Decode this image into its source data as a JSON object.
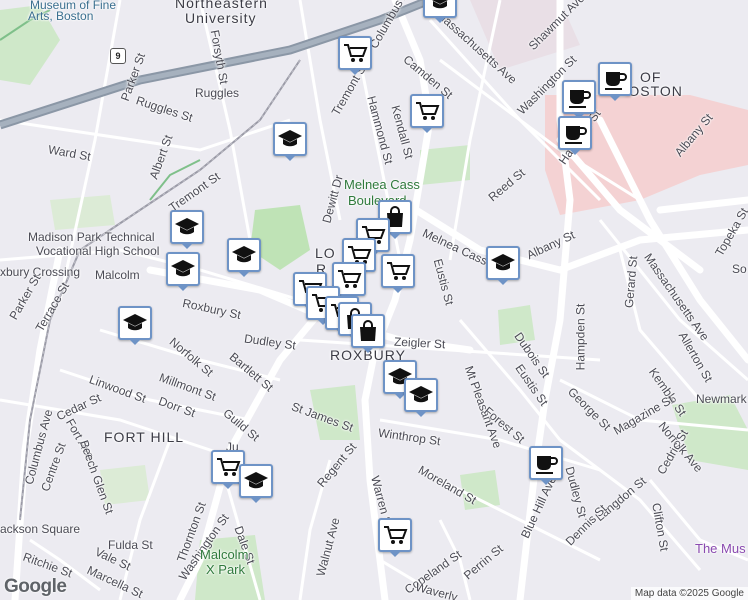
{
  "map": {
    "attribution": "Map data ©2025 Google",
    "logo": "Google",
    "labels": [
      {
        "id": "mfa",
        "text": "Museum of Fine",
        "cls": "teal"
      },
      {
        "id": "mfa2",
        "text": "Arts, Boston",
        "cls": "teal"
      },
      {
        "id": "neu",
        "text": "Northeastern",
        "cls": "big"
      },
      {
        "id": "neu2",
        "text": "University",
        "cls": "big"
      },
      {
        "id": "ruggles",
        "text": "Ruggles",
        "cls": ""
      },
      {
        "id": "ruggles_st",
        "text": "Ruggles St",
        "cls": ""
      },
      {
        "id": "parker",
        "text": "Parker St",
        "cls": ""
      },
      {
        "id": "forsyth",
        "text": "Forsyth St",
        "cls": ""
      },
      {
        "id": "ward",
        "text": "Ward St",
        "cls": ""
      },
      {
        "id": "albert",
        "text": "Albert St",
        "cls": ""
      },
      {
        "id": "tremont",
        "text": "Tremont St",
        "cls": ""
      },
      {
        "id": "tremont2",
        "text": "Tremont St",
        "cls": ""
      },
      {
        "id": "columbus_top",
        "text": "Columbus Av",
        "cls": ""
      },
      {
        "id": "hammond",
        "text": "Hammond St",
        "cls": ""
      },
      {
        "id": "kendall",
        "text": "Kendall St",
        "cls": ""
      },
      {
        "id": "camden",
        "text": "Camden St",
        "cls": ""
      },
      {
        "id": "mass_ave",
        "text": "Massachusetts Ave",
        "cls": ""
      },
      {
        "id": "shawmut",
        "text": "Shawmut Ave",
        "cls": ""
      },
      {
        "id": "washington",
        "text": "Washington St",
        "cls": ""
      },
      {
        "id": "of_boston",
        "text": "OF",
        "cls": "big"
      },
      {
        "id": "of_boston2",
        "text": "BOSTON",
        "cls": "big"
      },
      {
        "id": "dewitt",
        "text": "Dewitt Dr",
        "cls": ""
      },
      {
        "id": "melnea",
        "text": "Melnea Cass",
        "cls": "green"
      },
      {
        "id": "melnea2",
        "text": "Boulevard",
        "cls": "green"
      },
      {
        "id": "reed",
        "text": "Reed St",
        "cls": ""
      },
      {
        "id": "albany",
        "text": "Albany St",
        "cls": ""
      },
      {
        "id": "albany2",
        "text": "Albany St",
        "cls": ""
      },
      {
        "id": "hampton",
        "text": "Hampton St",
        "cls": ""
      },
      {
        "id": "madison",
        "text": "Madison Park Technical",
        "cls": ""
      },
      {
        "id": "madison2",
        "text": "Vocational High School",
        "cls": ""
      },
      {
        "id": "lo",
        "text": "LO",
        "cls": "big"
      },
      {
        "id": "ro",
        "text": "R",
        "cls": "big"
      },
      {
        "id": "melnea_cass",
        "text": "Melnea Cass",
        "cls": ""
      },
      {
        "id": "malcolm",
        "text": "Malcolm",
        "cls": ""
      },
      {
        "id": "xcrossing",
        "text": "xbury Crossing",
        "cls": ""
      },
      {
        "id": "roxbury_st",
        "text": "Roxbury St",
        "cls": ""
      },
      {
        "id": "parker2",
        "text": "Parker St",
        "cls": ""
      },
      {
        "id": "terrace",
        "text": "Terrace St",
        "cls": ""
      },
      {
        "id": "dudley",
        "text": "Dudley St",
        "cls": ""
      },
      {
        "id": "roxbury",
        "text": "ROXBURY",
        "cls": "big"
      },
      {
        "id": "zeigler",
        "text": "Zeigler St",
        "cls": ""
      },
      {
        "id": "eustis",
        "text": "Eustis St",
        "cls": ""
      },
      {
        "id": "eustis2",
        "text": "Eustis St",
        "cls": ""
      },
      {
        "id": "dubois",
        "text": "Dubois St",
        "cls": ""
      },
      {
        "id": "hampden",
        "text": "Hampden St",
        "cls": ""
      },
      {
        "id": "gerard",
        "text": "Gerard St",
        "cls": ""
      },
      {
        "id": "mass_ave2",
        "text": "Massachusetts Ave",
        "cls": ""
      },
      {
        "id": "topeka",
        "text": "Topeka St",
        "cls": ""
      },
      {
        "id": "so",
        "text": "So",
        "cls": ""
      },
      {
        "id": "allerton",
        "text": "Allerton St",
        "cls": ""
      },
      {
        "id": "kemble",
        "text": "Kemble St",
        "cls": ""
      },
      {
        "id": "newmark",
        "text": "Newmark",
        "cls": ""
      },
      {
        "id": "george",
        "text": "George St",
        "cls": ""
      },
      {
        "id": "magazine",
        "text": "Magazine St",
        "cls": ""
      },
      {
        "id": "norfolk_ave",
        "text": "Norfolk Ave",
        "cls": ""
      },
      {
        "id": "cedric",
        "text": "Cedric St",
        "cls": ""
      },
      {
        "id": "mt_pleasant",
        "text": "Mt Pleasant Ave",
        "cls": ""
      },
      {
        "id": "forest",
        "text": "Forest St",
        "cls": ""
      },
      {
        "id": "norfolk",
        "text": "Norfolk St",
        "cls": ""
      },
      {
        "id": "bartlett",
        "text": "Bartlett St",
        "cls": ""
      },
      {
        "id": "linwood",
        "text": "Linwood St",
        "cls": ""
      },
      {
        "id": "millmont",
        "text": "Millmont St",
        "cls": ""
      },
      {
        "id": "dorr",
        "text": "Dorr St",
        "cls": ""
      },
      {
        "id": "cedar",
        "text": "Cedar St",
        "cls": ""
      },
      {
        "id": "columbus",
        "text": "Columbus Ave",
        "cls": ""
      },
      {
        "id": "guild",
        "text": "Guild St",
        "cls": ""
      },
      {
        "id": "st_james",
        "text": "St James St",
        "cls": ""
      },
      {
        "id": "winthrop",
        "text": "Winthrop St",
        "cls": ""
      },
      {
        "id": "fort_hill",
        "text": "FORT HILL",
        "cls": "big"
      },
      {
        "id": "fort_ave",
        "text": "Fort Ave",
        "cls": ""
      },
      {
        "id": "centre",
        "text": "Centre St",
        "cls": ""
      },
      {
        "id": "beech",
        "text": "Beech Glen St",
        "cls": ""
      },
      {
        "id": "ju",
        "text": "Ju",
        "cls": ""
      },
      {
        "id": "regent",
        "text": "Regent St",
        "cls": ""
      },
      {
        "id": "moreland",
        "text": "Moreland St",
        "cls": ""
      },
      {
        "id": "blue_hill",
        "text": "Blue Hill Ave",
        "cls": ""
      },
      {
        "id": "dudley_st2",
        "text": "Dudley St",
        "cls": ""
      },
      {
        "id": "langdon",
        "text": "Langdon St",
        "cls": ""
      },
      {
        "id": "dennis",
        "text": "Dennis St",
        "cls": ""
      },
      {
        "id": "clifton",
        "text": "Clifton St",
        "cls": ""
      },
      {
        "id": "museum",
        "text": "The Mus",
        "cls": "purple"
      },
      {
        "id": "jackson",
        "text": "ackson Square",
        "cls": ""
      },
      {
        "id": "ritchie",
        "text": "Ritchie St",
        "cls": ""
      },
      {
        "id": "vale",
        "text": "Vale St",
        "cls": ""
      },
      {
        "id": "marcella",
        "text": "Marcella St",
        "cls": ""
      },
      {
        "id": "fulda",
        "text": "Fulda St",
        "cls": ""
      },
      {
        "id": "thornton",
        "text": "Thornton St",
        "cls": ""
      },
      {
        "id": "washington2",
        "text": "Washington St",
        "cls": ""
      },
      {
        "id": "dale",
        "text": "Dale St",
        "cls": ""
      },
      {
        "id": "walnut",
        "text": "Walnut Ave",
        "cls": ""
      },
      {
        "id": "warren",
        "text": "Warren St",
        "cls": ""
      },
      {
        "id": "copeland",
        "text": "Copeland St",
        "cls": ""
      },
      {
        "id": "perrin",
        "text": "Perrin St",
        "cls": ""
      },
      {
        "id": "waverly",
        "text": "Waverly",
        "cls": ""
      },
      {
        "id": "malcolm_x",
        "text": "Malcolm",
        "cls": "green"
      },
      {
        "id": "malcolm_x2",
        "text": "X Park",
        "cls": "green"
      }
    ],
    "shields": [
      {
        "id": "rt9",
        "text": "9"
      }
    ],
    "pins": [
      {
        "id": "p1",
        "icon": "cart"
      },
      {
        "id": "p2",
        "icon": "cart"
      },
      {
        "id": "p3",
        "icon": "coffee"
      },
      {
        "id": "p4",
        "icon": "coffee"
      },
      {
        "id": "p5",
        "icon": "coffee"
      },
      {
        "id": "p6",
        "icon": "school"
      },
      {
        "id": "p7",
        "icon": "shopping-bag"
      },
      {
        "id": "p8",
        "icon": "school"
      },
      {
        "id": "p9",
        "icon": "school"
      },
      {
        "id": "p10",
        "icon": "school"
      },
      {
        "id": "p11",
        "icon": "school"
      },
      {
        "id": "p12",
        "icon": "cart"
      },
      {
        "id": "p13",
        "icon": "cart"
      },
      {
        "id": "p14",
        "icon": "cart"
      },
      {
        "id": "p15",
        "icon": "cart"
      },
      {
        "id": "p16",
        "icon": "cart"
      },
      {
        "id": "p17",
        "icon": "cart"
      },
      {
        "id": "p18",
        "icon": "cart"
      },
      {
        "id": "p19",
        "icon": "shopping-bag"
      },
      {
        "id": "p20",
        "icon": "shopping-bag"
      },
      {
        "id": "p21",
        "icon": "school"
      },
      {
        "id": "p22",
        "icon": "school"
      },
      {
        "id": "p23",
        "icon": "school"
      },
      {
        "id": "p24",
        "icon": "coffee"
      },
      {
        "id": "p25",
        "icon": "cart"
      },
      {
        "id": "p26",
        "icon": "school"
      },
      {
        "id": "p27",
        "icon": "cart"
      },
      {
        "id": "p28",
        "icon": "school"
      }
    ]
  }
}
